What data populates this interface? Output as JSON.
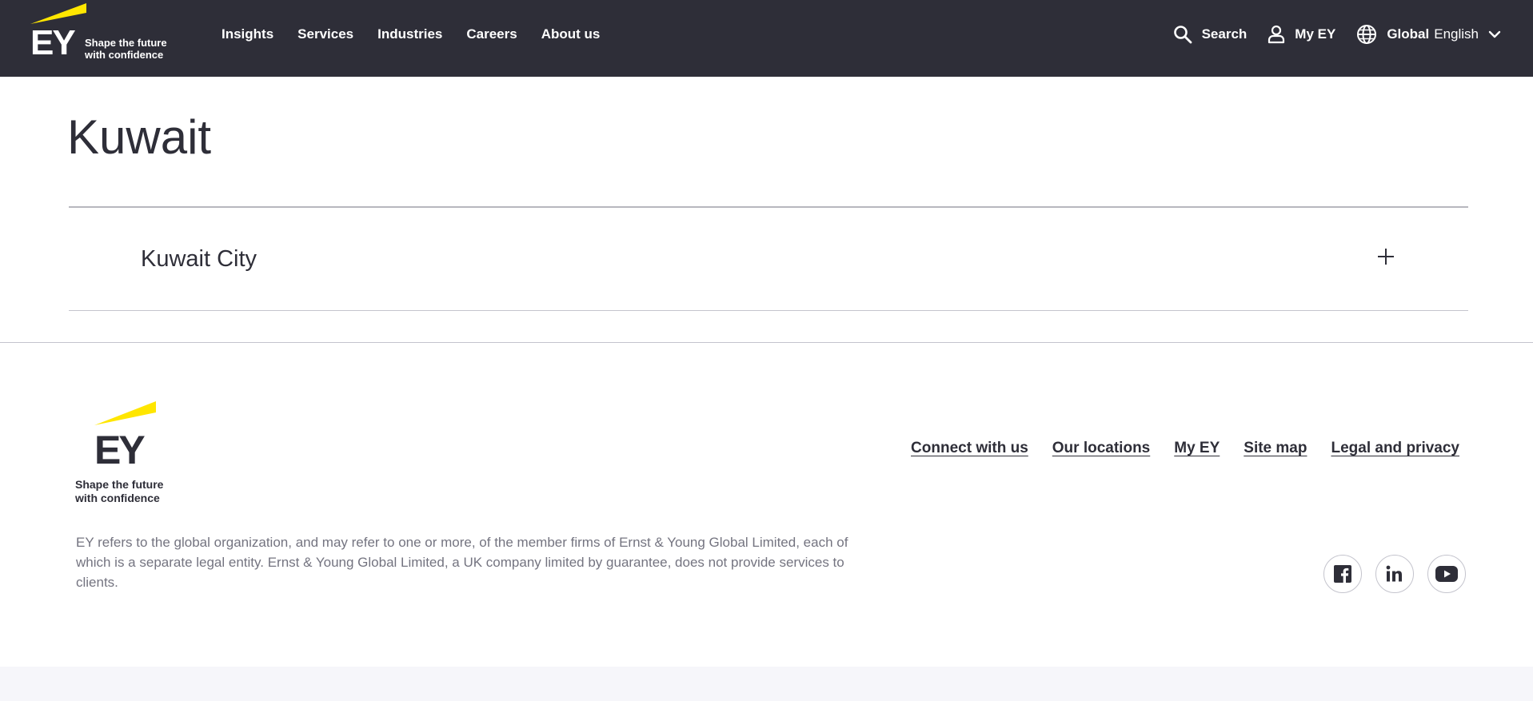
{
  "header": {
    "logo_text": "EY",
    "tagline_line1": "Shape the future",
    "tagline_line2": "with confidence",
    "nav": [
      {
        "label": "Insights"
      },
      {
        "label": "Services"
      },
      {
        "label": "Industries"
      },
      {
        "label": "Careers"
      },
      {
        "label": "About us"
      }
    ],
    "search_label": "Search",
    "myey_label": "My EY",
    "region_label": "Global",
    "language_label": "English"
  },
  "main": {
    "title": "Kuwait",
    "accordion": [
      {
        "label": "Kuwait City",
        "expanded": false
      }
    ]
  },
  "footer": {
    "logo_text": "EY",
    "tagline_line1": "Shape the future",
    "tagline_line2": "with confidence",
    "links": [
      {
        "label": "Connect with us"
      },
      {
        "label": "Our locations"
      },
      {
        "label": "My EY"
      },
      {
        "label": "Site map"
      },
      {
        "label": "Legal and privacy"
      }
    ],
    "disclaimer": "EY refers to the global organization, and may refer to one or more, of the member firms of Ernst & Young Global Limited, each of which is a separate legal entity. Ernst & Young Global Limited, a UK company limited by guarantee, does not provide services to clients.",
    "social": [
      {
        "icon": "facebook-icon"
      },
      {
        "icon": "linkedin-icon"
      },
      {
        "icon": "youtube-icon"
      }
    ]
  },
  "colors": {
    "header_bg": "#2e2e38",
    "brand_yellow": "#ffe600",
    "text_dark": "#2e2e38",
    "text_gray": "#747480"
  }
}
